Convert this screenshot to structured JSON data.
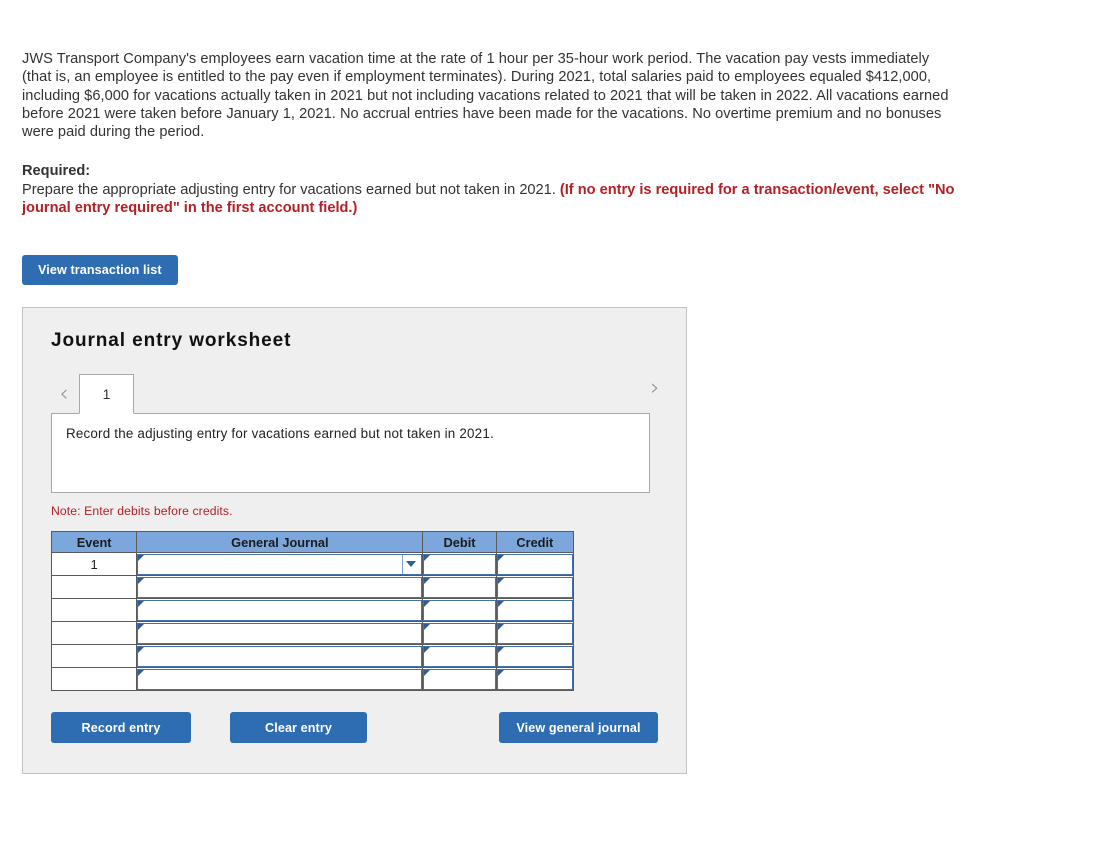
{
  "problem": {
    "statement": "JWS Transport Company's employees earn vacation time at the rate of 1 hour per 35-hour work period. The vacation pay vests immediately (that is, an employee is entitled to the pay even if employment terminates). During 2021, total salaries paid to employees equaled $412,000, including $6,000 for vacations actually taken in 2021 but not including vacations related to 2021 that will be taken in 2022. All vacations earned before 2021 were taken before January 1, 2021. No accrual entries have been made for the vacations. No overtime premium and no bonuses were paid during the period.",
    "required_label": "Required:",
    "required_text": "Prepare the appropriate adjusting entry for vacations earned but not taken in 2021. ",
    "required_hint": "(If no entry is required for a transaction/event, select \"No journal entry required\" in the first account field.)"
  },
  "toolbar": {
    "view_transaction_list": "View transaction list"
  },
  "worksheet": {
    "title": "Journal entry worksheet",
    "prev_icon": "‹",
    "next_icon": "›",
    "tabs": [
      {
        "label": "1",
        "active": true
      }
    ],
    "description": "Record the adjusting entry for vacations earned but not taken in 2021.",
    "note": "Note: Enter debits before credits.",
    "table": {
      "columns": [
        "Event",
        "General Journal",
        "Debit",
        "Credit"
      ],
      "rows": [
        {
          "event": "1",
          "general_journal": "",
          "debit": "",
          "credit": "",
          "has_dropdown": true
        },
        {
          "event": "",
          "general_journal": "",
          "debit": "",
          "credit": "",
          "has_dropdown": false
        },
        {
          "event": "",
          "general_journal": "",
          "debit": "",
          "credit": "",
          "has_dropdown": false
        },
        {
          "event": "",
          "general_journal": "",
          "debit": "",
          "credit": "",
          "has_dropdown": false
        },
        {
          "event": "",
          "general_journal": "",
          "debit": "",
          "credit": "",
          "has_dropdown": false
        },
        {
          "event": "",
          "general_journal": "",
          "debit": "",
          "credit": "",
          "has_dropdown": false
        }
      ]
    },
    "buttons": {
      "record_entry": "Record entry",
      "clear_entry": "Clear entry",
      "view_general_journal": "View general journal"
    }
  },
  "colors": {
    "button_blue": "#2f6db3",
    "table_header_blue": "#7ba7dc",
    "field_border_blue": "#4472a8",
    "alert_red": "#b32025",
    "panel_gray": "#efefef"
  }
}
